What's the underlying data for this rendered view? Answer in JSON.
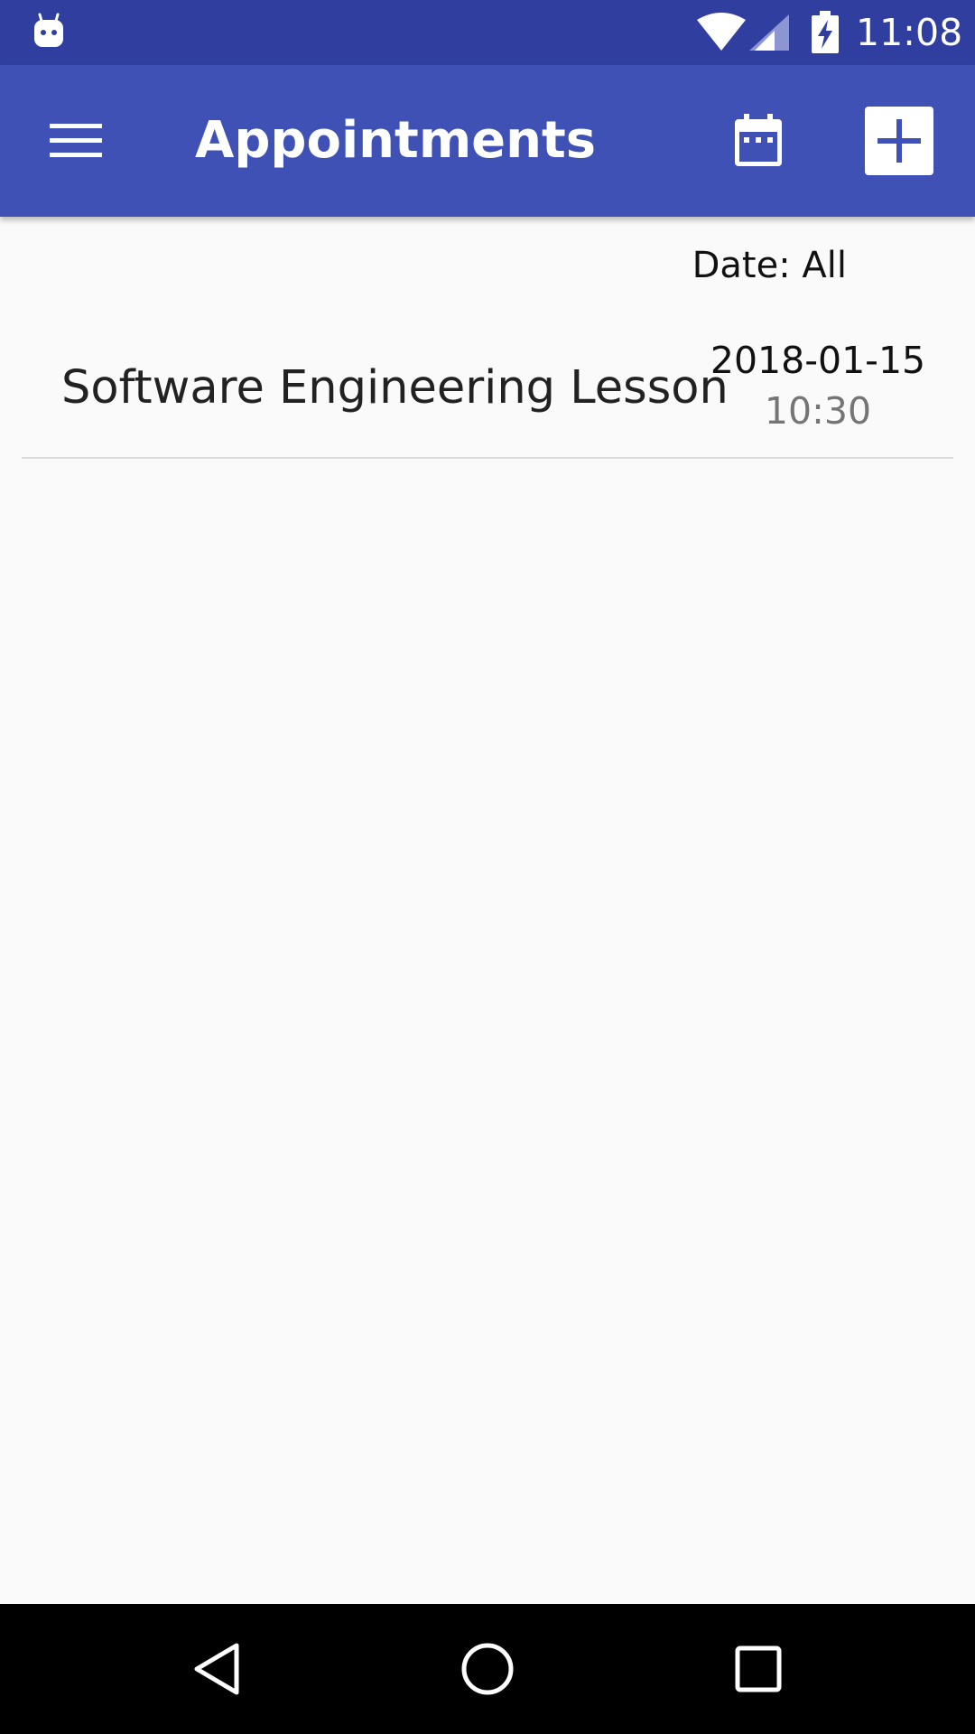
{
  "status_bar": {
    "time": "11:08",
    "icons": [
      "android-robot-icon",
      "wifi-icon",
      "signal-icon",
      "battery-charging-icon"
    ]
  },
  "app_bar": {
    "title": "Appointments",
    "icons": [
      "menu-icon",
      "calendar-icon",
      "add-icon"
    ],
    "color": "#3f51b5",
    "status_color": "#303f9f"
  },
  "filter": {
    "date_label": "Date: All"
  },
  "appointments": [
    {
      "title": "Software Engineering Lesson",
      "date": "2018-01-15",
      "time": "10:30"
    }
  ],
  "nav_bar": {
    "icons": [
      "back-icon",
      "home-icon",
      "recents-icon"
    ]
  }
}
